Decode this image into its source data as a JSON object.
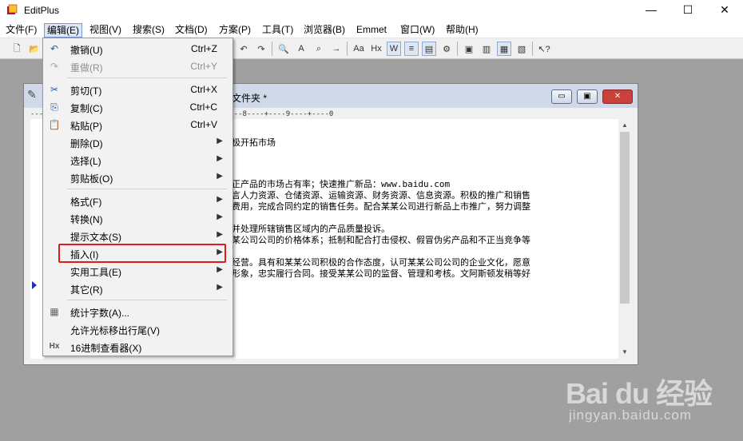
{
  "window": {
    "title": "EditPlus"
  },
  "window_buttons": {
    "minimize": "—",
    "maximize": "☐",
    "close": "✕"
  },
  "menubar": {
    "items": [
      {
        "label": "文件(F)"
      },
      {
        "label": "编辑(E)"
      },
      {
        "label": "视图(V)"
      },
      {
        "label": "搜索(S)"
      },
      {
        "label": "文档(D)"
      },
      {
        "label": "方案(P)"
      },
      {
        "label": "工具(T)"
      },
      {
        "label": "浏览器(B)"
      },
      {
        "label": "Emmet"
      },
      {
        "label": "窗口(W)"
      },
      {
        "label": "帮助(H)"
      }
    ]
  },
  "document": {
    "title_suffix": "文件夹 *",
    "ruler": "----+----4----+----5----+----6----+----7----+----8----+----9----+----0",
    "lines": [
      "极开拓市场",
      "正产品的市场占有率；快速推广新品：www.baidu.com",
      "言人力资源、仓储资源、运输资源、财务资源、信息资源。积极的推广和销售",
      "费用，完成合同约定的销售任务。配合某某公司进行新品上市推广，努力调整",
      "并处理所辖销售区域内的产品质量投诉。",
      "某公司公司的价格体系；抵制和配合打击侵权、假冒伪劣产品和不正当竞争等",
      "经营。具有和某某公司积极的合作态度，认可某某公司公司的企业文化，愿意",
      "形象，忠实履行合同。接受某某公司的监督、管理和考核。文阿斯顿发稍等好"
    ]
  },
  "edit_menu": {
    "items": [
      {
        "icon": "↶",
        "label": "撤销(U)",
        "shortcut": "Ctrl+Z",
        "disabled": false
      },
      {
        "icon": "↷",
        "label": "重做(R)",
        "shortcut": "Ctrl+Y",
        "disabled": true
      },
      {
        "icon": "✂",
        "label": "剪切(T)",
        "shortcut": "Ctrl+X",
        "disabled": false
      },
      {
        "icon": "⎘",
        "label": "复制(C)",
        "shortcut": "Ctrl+C",
        "disabled": false
      },
      {
        "icon": "📋",
        "label": "粘贴(P)",
        "shortcut": "Ctrl+V",
        "disabled": false
      },
      {
        "label": "删除(D)",
        "submenu": true
      },
      {
        "label": "选择(L)",
        "submenu": true
      },
      {
        "label": "剪贴板(O)",
        "submenu": true
      },
      {
        "label": "格式(F)",
        "submenu": true
      },
      {
        "label": "转换(N)",
        "submenu": true
      },
      {
        "label": "提示文本(S)",
        "submenu": true
      },
      {
        "label": "插入(I)",
        "submenu": true,
        "highlighted": true
      },
      {
        "label": "实用工具(E)",
        "submenu": true
      },
      {
        "label": "其它(R)",
        "submenu": true
      },
      {
        "icon": "▦",
        "label": "统计字数(A)..."
      },
      {
        "label": "允许光标移出行尾(V)"
      },
      {
        "icon": "Hx",
        "label": "16进制查看器(X)"
      }
    ]
  },
  "watermark": {
    "logo": "Bai du 经验",
    "url": "jingyan.baidu.com"
  },
  "colors": {
    "highlight_border": "#e01b1b",
    "active_menu_bg": "#dce6f4"
  }
}
